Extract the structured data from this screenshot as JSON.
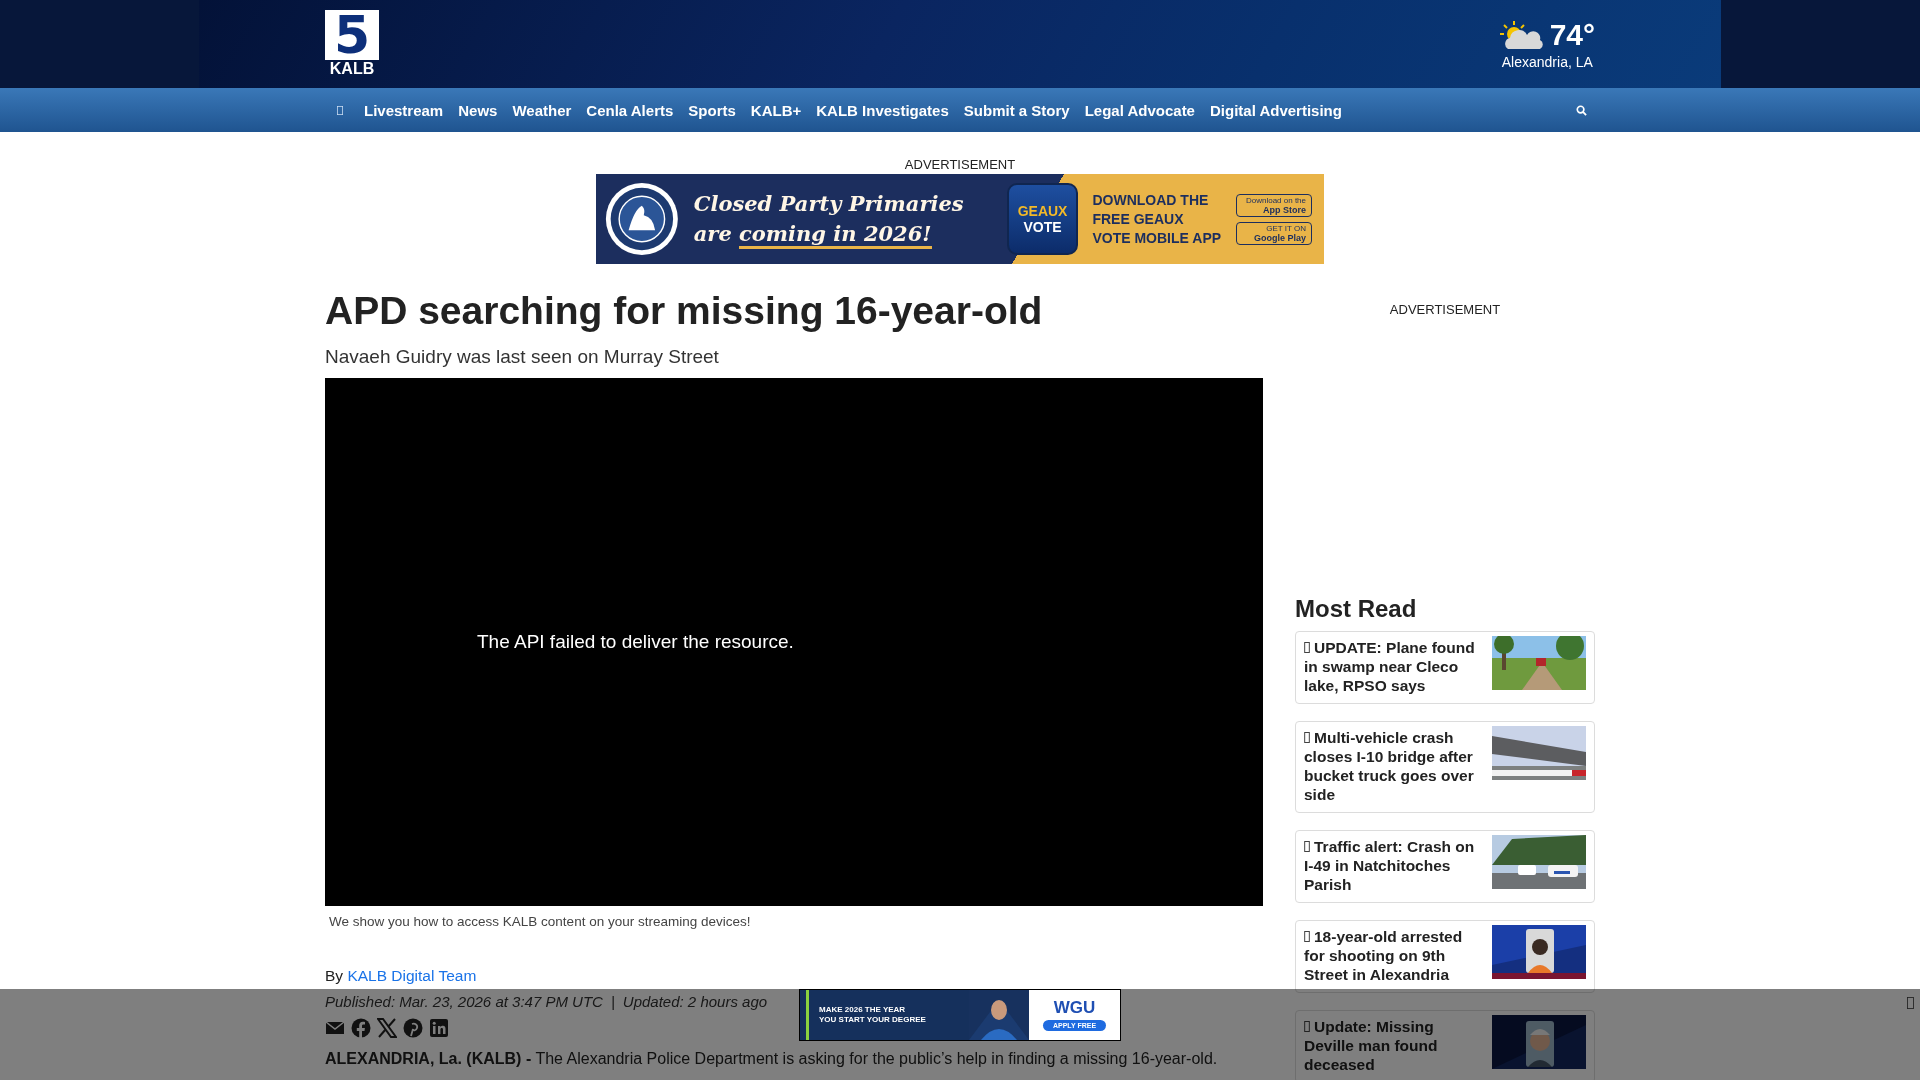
{
  "header": {
    "logo": {
      "numeral": "5",
      "name": "KALB"
    },
    "weather": {
      "temperature": "74°",
      "location": "Alexandria, LA"
    }
  },
  "nav": {
    "items": [
      {
        "kind": "home"
      },
      {
        "kind": "link",
        "label": "Livestream"
      },
      {
        "kind": "link",
        "label": "News"
      },
      {
        "kind": "link",
        "label": "Weather"
      },
      {
        "kind": "link",
        "label": "Cenla Alerts"
      },
      {
        "kind": "link",
        "label": "Sports"
      },
      {
        "kind": "link",
        "label": "KALB+"
      },
      {
        "kind": "link",
        "label": "KALB Investigates"
      },
      {
        "kind": "link",
        "label": "Submit a Story"
      },
      {
        "kind": "link",
        "label": "Legal Advocate"
      },
      {
        "kind": "link",
        "label": "Digital Advertising"
      }
    ]
  },
  "top_ad": {
    "label": "ADVERTISEMENT",
    "headline_1": "Closed Party Primaries",
    "headline_2_start": "are ",
    "headline_2_underlined": "coming in 2026!",
    "app_name_1": "GEAUX",
    "app_name_2": "VOTE",
    "call_to_action": "DOWNLOAD THE FREE GEAUX VOTE MOBILE APP",
    "store_buttons": [
      {
        "small": "Download on the",
        "big": "App Store"
      },
      {
        "small": "GET IT ON",
        "big": "Google Play"
      }
    ]
  },
  "article": {
    "title": "APD searching for missing 16-year-old",
    "subtitle": "Navaeh Guidry was last seen on Murray Street",
    "video": {
      "message": "The API failed to deliver the resource."
    },
    "caption": "We show you how to access KALB content on your streaming devices!",
    "byline": {
      "prefix": "By",
      "author": "KALB Digital Team"
    },
    "published": "Published: Mar. 23, 2026 at 3:47 PM UTC",
    "separator": "|",
    "updated": "Updated: 2 hours ago",
    "body": "**ALEXANDRIA, La. (KALB) -** The Alexandria Police Department is asking for the public’s help in finding a missing 16-year-old."
  },
  "sidebar": {
    "ad_label": "ADVERTISEMENT",
    "most_read": {
      "title": "Most Read",
      "items": [
        {
          "headline": "UPDATE: Plane found in swamp near Cleco lake, RPSO says"
        },
        {
          "headline": "Multi-vehicle crash closes I-10 bridge after bucket truck goes over side"
        },
        {
          "headline": "Traffic alert: Crash on I-49 in Natchitoches Parish"
        },
        {
          "headline": "18-year-old arrested for shooting on 9th Street in Alexandria"
        },
        {
          "headline": "Update: Missing Deville man found deceased"
        }
      ]
    }
  },
  "sticky_ad": {
    "line_1": "MAKE 2026 THE YEAR",
    "line_2": "YOU START YOUR DEGREE",
    "brand": "WGU",
    "button": "APPLY FREE"
  }
}
